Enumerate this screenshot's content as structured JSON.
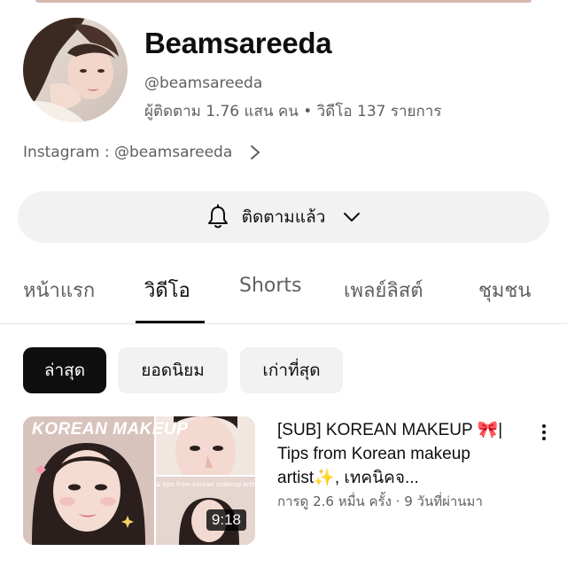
{
  "channel": {
    "name": "Beamsareeda",
    "handle": "@beamsareeda",
    "stats": "ผู้ติดตาม 1.76 แสน คน • วิดีโอ 137 รายการ",
    "link": "Instagram : @beamsareeda"
  },
  "subscribe": {
    "label": "ติดตามแล้ว"
  },
  "tabs": [
    {
      "label": "หน้าแรก"
    },
    {
      "label": "วิดีโอ"
    },
    {
      "label": "Shorts"
    },
    {
      "label": "เพลย์ลิสต์"
    },
    {
      "label": "ชุมชน"
    }
  ],
  "active_tab": "วิดีโอ",
  "filters": [
    {
      "label": "ล่าสุด"
    },
    {
      "label": "ยอดนิยม"
    },
    {
      "label": "เก่าที่สุด"
    }
  ],
  "selected_filter": "ล่าสุด",
  "video": {
    "title": "[SUB] KOREAN MAKEUP 🎀| Tips from Korean makeup artist✨, เทคนิคจ...",
    "meta": "การดู 2.6 หมื่น ครั้ง · 9 วันที่ผ่านมา",
    "duration": "9:18",
    "thumbnail_title": "KOREAN MAKEUP",
    "thumbnail_caption": "& tips from korean makeup artist!"
  },
  "icons": {
    "bell": "bell-icon",
    "chevron_down": "chevron-down-icon",
    "chevron_right": "chevron-right-icon",
    "more": "more-vert-icon"
  },
  "colors": {
    "text_primary": "#0f0f0f",
    "text_secondary": "#606060",
    "chip_background": "#f2f2f2",
    "chip_selected": "#0f0f0f"
  }
}
